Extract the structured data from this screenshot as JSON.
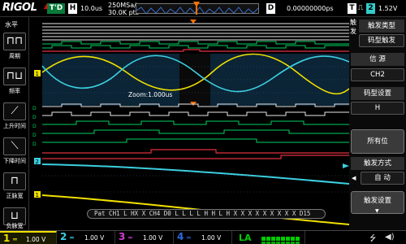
{
  "header": {
    "logo": "RIGOL",
    "run_status": "T'D",
    "horizontal_key": "H",
    "timebase": "10.0us",
    "sample_rate": "250MSa/s",
    "memory_depth": "30.0K pts",
    "delay_key": "D",
    "delay_offset": "0.00000000ps",
    "trigger_key": "T",
    "trigger_channel": "2",
    "trigger_level": "1.52V"
  },
  "left_panel": {
    "title": "水平",
    "buttons": [
      {
        "label": "周期",
        "icon": "period-icon"
      },
      {
        "label": "频率",
        "icon": "frequency-icon"
      },
      {
        "label": "上升时间",
        "icon": "rise-time-icon"
      },
      {
        "label": "下降时间",
        "icon": "fall-time-icon"
      },
      {
        "label": "正脉宽",
        "icon": "positive-width-icon"
      },
      {
        "label": "负脉宽",
        "icon": "negative-width-icon"
      }
    ]
  },
  "right_menu": {
    "side_label": "触 发",
    "items": [
      {
        "heading": "触发类型",
        "value": "码型触发"
      },
      {
        "heading": "信 源",
        "value": "CH2"
      },
      {
        "heading": "码型设置",
        "value": "H"
      },
      {
        "button": "所有位"
      },
      {
        "heading": "触发方式",
        "value": "自 动"
      },
      {
        "button": "触发设置"
      }
    ]
  },
  "screen": {
    "zoom_label": "Zoom:1.000us",
    "pattern_readout": "Pat  CH1  L HX X   CH4  D0  L L L L H H L H X X X X X X X X X  D15"
  },
  "channels": [
    {
      "num": "1",
      "scale": "1.00 V",
      "color": "#f0e000",
      "active": true
    },
    {
      "num": "2",
      "scale": "1.00 V",
      "color": "#3cd0e0",
      "active": false
    },
    {
      "num": "3",
      "scale": "1.00 V",
      "color": "#d040d0",
      "active": false
    },
    {
      "num": "4",
      "scale": "1.00 V",
      "color": "#2d6ae0",
      "active": false
    }
  ],
  "la": {
    "label": "LA"
  },
  "colors": {
    "ch1": "#f0e000",
    "ch2": "#3cd0e0",
    "digital_high": "#00d060",
    "digital_bus": "#e03040",
    "trigger": "#ff7000",
    "zoom_window": "#123a5a"
  }
}
